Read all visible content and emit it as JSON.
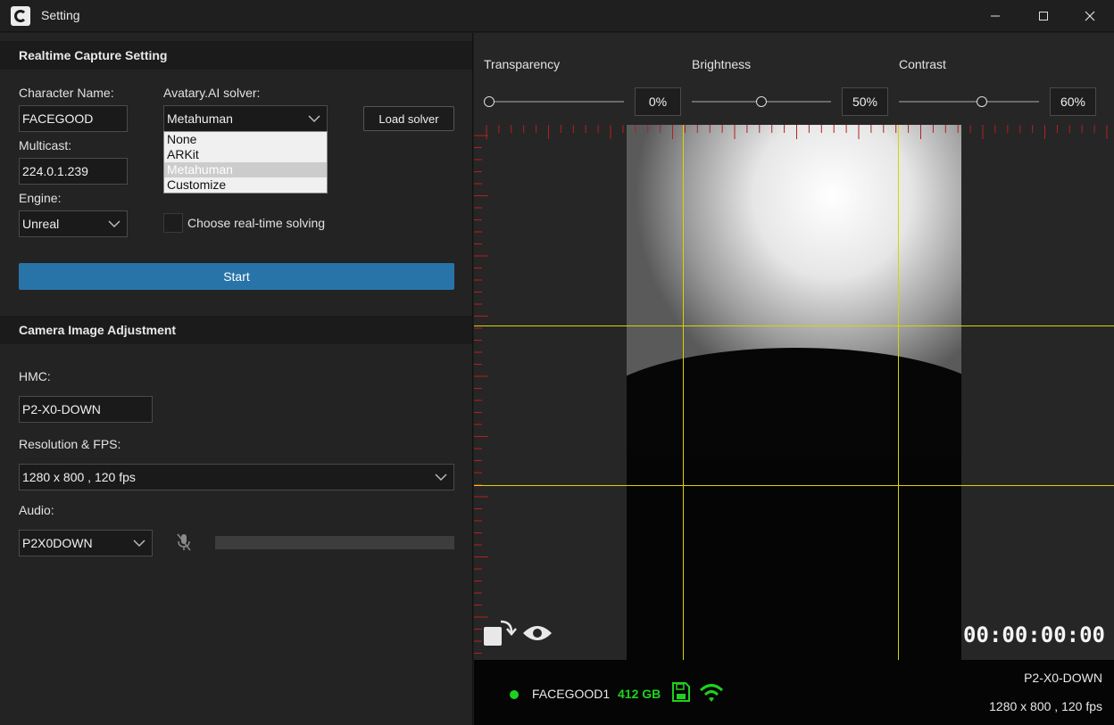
{
  "window": {
    "title": "Setting"
  },
  "capture": {
    "section_title": "Realtime Capture Setting",
    "character_name_label": "Character Name:",
    "character_name_value": "FACEGOOD",
    "solver_label": "Avatary.AI solver:",
    "solver_value": "Metahuman",
    "solver_options": [
      "None",
      "ARKit",
      "Metahuman",
      "Customize"
    ],
    "load_solver_label": "Load solver",
    "multicast_label": "Multicast:",
    "multicast_value": "224.0.1.239",
    "engine_label": "Engine:",
    "engine_value": "Unreal",
    "realtime_solving_label": "Choose real-time solving",
    "start_label": "Start"
  },
  "camera": {
    "section_title": "Camera Image Adjustment",
    "hmc_label": "HMC:",
    "hmc_value": "P2-X0-DOWN",
    "resolution_label": "Resolution & FPS:",
    "resolution_value": "1280 x 800 , 120 fps",
    "audio_label": "Audio:",
    "audio_value": "P2X0DOWN"
  },
  "adjust": {
    "transparency_label": "Transparency",
    "transparency_value": "0%",
    "brightness_label": "Brightness",
    "brightness_value": "50%",
    "contrast_label": "Contrast",
    "contrast_value": "60%"
  },
  "preview": {
    "timecode": "00:00:00:00",
    "device_name": "FACEGOOD1",
    "storage": "412 GB",
    "hmc_name": "P2-X0-DOWN",
    "resolution": "1280 x 800 , 120 fps"
  },
  "colors": {
    "accent": "#2874a8",
    "status_green": "#1fd11f",
    "guide_yellow": "#d9d400",
    "ruler_red": "#b32020"
  }
}
